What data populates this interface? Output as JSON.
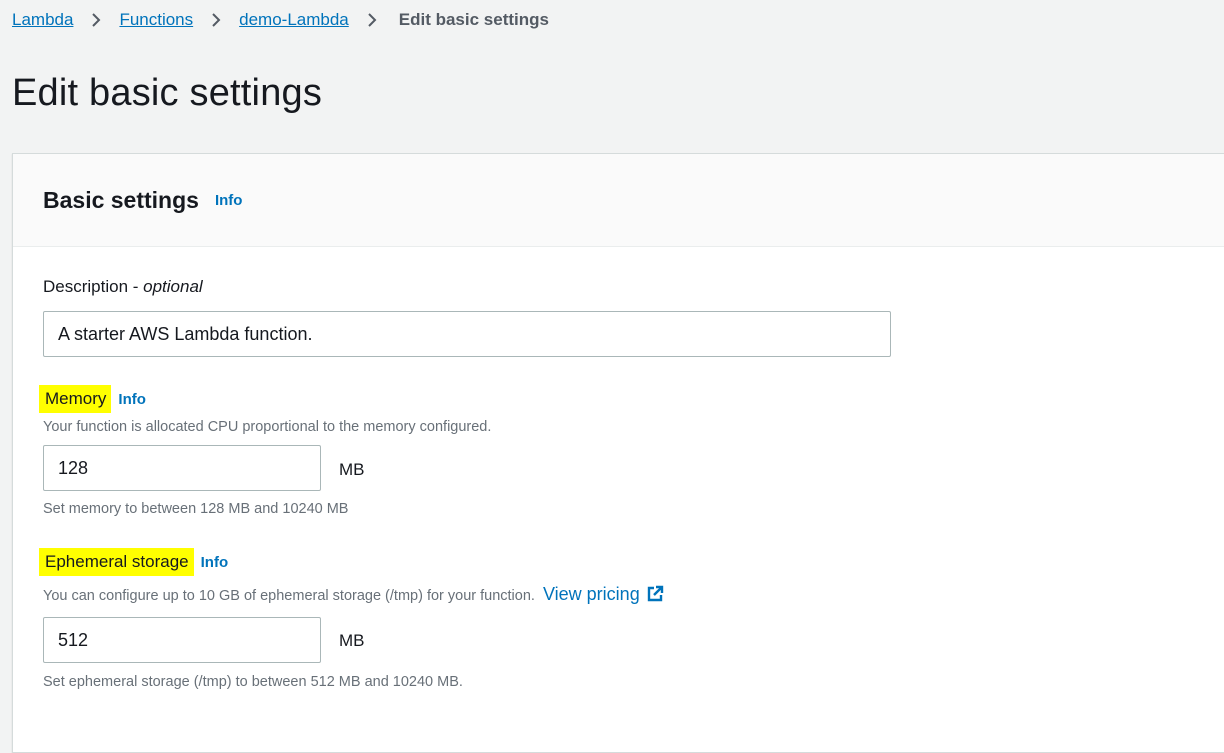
{
  "breadcrumbs": {
    "items": [
      "Lambda",
      "Functions",
      "demo-Lambda"
    ],
    "current": "Edit basic settings"
  },
  "page": {
    "title": "Edit basic settings"
  },
  "panel": {
    "title": "Basic settings",
    "info": "Info"
  },
  "description": {
    "label": "Description - ",
    "label_suffix": "optional",
    "value": "A starter AWS Lambda function."
  },
  "memory": {
    "label": "Memory",
    "info": "Info",
    "description": "Your function is allocated CPU proportional to the memory configured.",
    "value": "128",
    "unit": "MB",
    "constraint": "Set memory to between 128 MB and 10240 MB"
  },
  "ephemeral": {
    "label": "Ephemeral storage",
    "info": "Info",
    "description": "You can configure up to 10 GB of ephemeral storage (/tmp) for your function.",
    "pricing_link": "View pricing",
    "value": "512",
    "unit": "MB",
    "constraint": "Set ephemeral storage (/tmp) to between 512 MB and 10240 MB."
  },
  "colors": {
    "link": "#0073bb",
    "highlight": "#ffff00",
    "background": "#f2f3f3"
  },
  "icons": {
    "separator": "chevron-right-icon",
    "external": "external-link-icon"
  }
}
